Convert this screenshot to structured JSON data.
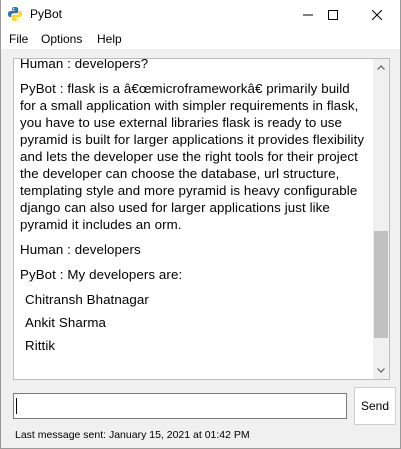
{
  "window": {
    "title": "PyBot",
    "icon": "python-icon"
  },
  "menu": [
    {
      "label": "File"
    },
    {
      "label": "Options"
    },
    {
      "label": "Help"
    }
  ],
  "chat": {
    "messages": [
      {
        "text": "Human : developers?"
      },
      {
        "text": "PyBot : flask is a â€œmicroframeworkâ€ primarily build for a small application with simpler requirements in flask, you have to use external libraries flask is ready to use pyramid is built for larger applications it provides flexibility and lets the developer use the right tools for their project the developer can choose the database, url structure, templating style and more pyramid is heavy configurable django can also used for larger applications just like pyramid it includes an orm."
      },
      {
        "text": "Human : developers"
      },
      {
        "text": "PyBot : My developers are:"
      }
    ],
    "developers": [
      "Chitransh Bhatnagar",
      "Ankit Sharma",
      "Rittik"
    ]
  },
  "input": {
    "value": "",
    "send_label": "Send"
  },
  "status": {
    "text": "Last message sent: January 15, 2021 at 01:42 PM"
  }
}
